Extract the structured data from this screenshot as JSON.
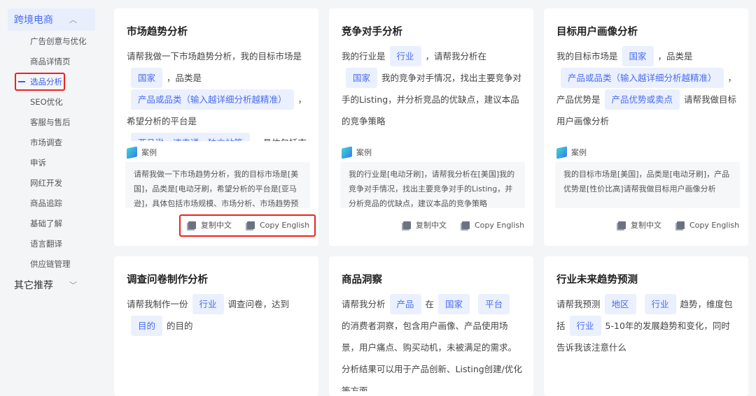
{
  "sidebar": {
    "group_open": "跨境电商",
    "group_closed": "其它推荐",
    "items": [
      "广告创意与优化",
      "商品详情页",
      "选品分析",
      "SEO优化",
      "客服与售后",
      "市场调查",
      "申诉",
      "网红开发",
      "商品追踪",
      "基础了解",
      "语言翻译",
      "供应链管理"
    ],
    "active_index": 2
  },
  "common": {
    "case_label": "案例",
    "copy_cn": "复制中文",
    "copy_en": "Copy English"
  },
  "cards": [
    {
      "title": "市场趋势分析",
      "segments": [
        {
          "t": "请帮我做一下市场趋势分析，我的目标市场是"
        },
        {
          "tag": "国家"
        },
        {
          "t": "，品类是"
        },
        {
          "tag": "产品或品类（输入越详细分析越精准）"
        },
        {
          "t": "，希望分析的平台是"
        },
        {
          "tag": "亚马逊、速卖通、独立站等"
        },
        {
          "t": "，具体包括市"
        }
      ],
      "example": "请帮我做一下市场趋势分析，我的目标市场是[美国]，品类是[电动牙刷，希望分析的平台是[亚马逊]，具体包括市场规模、市场分析、市场趋势预"
    },
    {
      "title": "竞争对手分析",
      "segments": [
        {
          "t": "我的行业是"
        },
        {
          "tag": "行业"
        },
        {
          "t": "，请帮我分析在"
        },
        {
          "tag": "国家"
        },
        {
          "t": "我的竞争对手情况，找出主要竞争对手的Listing，并分析竞品的优缺点，建议本品的竞争策略"
        }
      ],
      "example": "我的行业是[电动牙刷]，请帮我分析在[美国]我的竞争对手情况，找出主要竞争对手的Listing，并分析竞品的优缺点，建议本品的竞争策略"
    },
    {
      "title": "目标用户画像分析",
      "segments": [
        {
          "t": "我的目标市场是"
        },
        {
          "tag": "国家"
        },
        {
          "t": "，品类是"
        },
        {
          "tag": "产品或品类（输入越详细分析越精准）"
        },
        {
          "t": "，产品优势是"
        },
        {
          "tag": "产品优势或卖点"
        },
        {
          "t": "请帮我做目标用户画像分析"
        }
      ],
      "example": "我的目标市场是[美国]，品类是[电动牙刷]，产品优势是[性价比高]请帮我做目标用户画像分析"
    },
    {
      "title": "调查问卷制作分析",
      "segments": [
        {
          "t": "请帮我制作一份"
        },
        {
          "tag": "行业"
        },
        {
          "t": "调查问卷，达到"
        },
        {
          "tag": "目的"
        },
        {
          "t": "的目的"
        }
      ]
    },
    {
      "title": "商品洞察",
      "segments": [
        {
          "t": "请帮我分析"
        },
        {
          "tag": "产品"
        },
        {
          "t": "在"
        },
        {
          "tag": "国家"
        },
        {
          "tag": "平台"
        },
        {
          "t": "的消费者洞察，包含用户画像、产品使用场景，用户痛点、购买动机，未被满足的需求。分析结果可以用于产品创新、Listing创建/优化等方面。"
        }
      ]
    },
    {
      "title": "行业未来趋势预测",
      "segments": [
        {
          "t": "请帮我预测"
        },
        {
          "tag": "地区"
        },
        {
          "tag": "行业"
        },
        {
          "t": "趋势，维度包括"
        },
        {
          "tag": "行业"
        },
        {
          "t": "5-10年的发展趋势和变化，同时告诉我该注意什么"
        }
      ]
    }
  ]
}
